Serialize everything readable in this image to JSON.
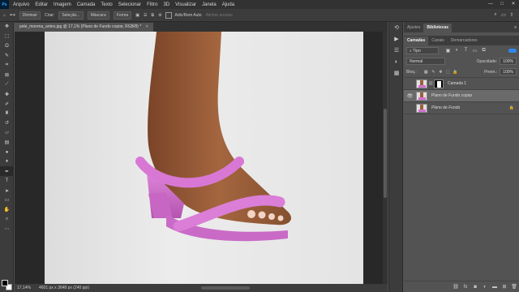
{
  "menu": {
    "logo": "Ps",
    "items": [
      "Arquivo",
      "Editar",
      "Imagem",
      "Camada",
      "Texto",
      "Selecionar",
      "Filtro",
      "3D",
      "Visualizar",
      "Janela",
      "Ajuda"
    ],
    "window_controls": [
      "—",
      "□",
      "✕"
    ]
  },
  "options": {
    "mode_select": "Diminuir",
    "criar_label": "Criar:",
    "selection_btn": "Seleção...",
    "mask_btn": "Máscara",
    "shape_btn": "Forma",
    "auto_add_label": "Adic/Rem Auto",
    "align_edges_label": "Alinhar arestas"
  },
  "document": {
    "tab_title": "pele_morena_antes.jpg @ 17,1% (Plano de Fundo copiar, RGB/8) *",
    "zoom": "17,14%",
    "dimensions": "4601 px x 3648 px (240 ppi)"
  },
  "panel": {
    "top_tabs": [
      "Ajustes",
      "Bibliotecas"
    ],
    "active_top_tab": "Bibliotecas",
    "tabs": [
      "Camadas",
      "Canais",
      "Demarcadores"
    ],
    "active_tab": "Camadas",
    "filter_kind": "Tipo",
    "blend_mode": "Normal",
    "opacity_label": "Opacidade:",
    "opacity_value": "100%",
    "lock_label": "Bloq.:",
    "fill_label": "Preen.:",
    "fill_value": "100%",
    "layers": [
      {
        "name": "Camada 1",
        "visible": false,
        "has_mask": true
      },
      {
        "name": "Plano de Fundo copiar",
        "visible": true,
        "active": true
      },
      {
        "name": "Plano de Fundo",
        "visible": false,
        "locked": true
      }
    ]
  },
  "colors": {
    "accent": "#2f8af0",
    "shoe": "#d46fd0",
    "skin": "#9a5f3c"
  }
}
